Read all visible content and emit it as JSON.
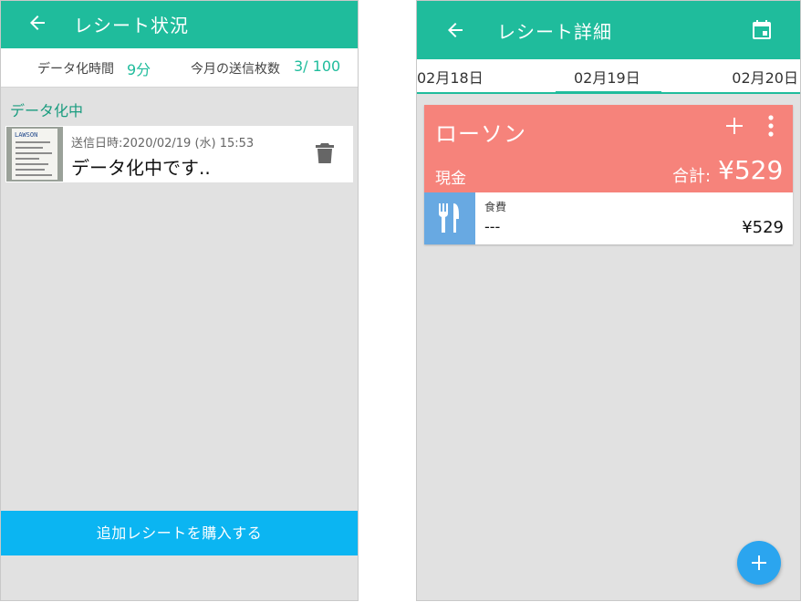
{
  "status_screen": {
    "title": "レシート状況",
    "data_time_label": "データ化時間",
    "data_time_value": "9分",
    "monthly_label": "今月の送信枚数",
    "monthly_value": "3/ 100",
    "section_title": "データ化中",
    "receipt": {
      "thumbnail_logo": "LAWSON",
      "sent": "送信日時:2020/02/19 (水) 15:53",
      "status": "データ化中です.."
    },
    "buy_button": "追加レシートを購入する"
  },
  "detail_screen": {
    "title": "レシート詳細",
    "dates": [
      "02月18日",
      "02月19日",
      "02月20日"
    ],
    "selected_date_index": 1,
    "card": {
      "store": "ローソン",
      "payment": "現金",
      "total_label": "合計:",
      "total_value": "¥529",
      "header_color": "#f6837b",
      "item": {
        "icon": "fork-knife-icon",
        "icon_color": "#68a9e2",
        "category": "食費",
        "memo": "---",
        "price": "¥529"
      }
    }
  },
  "colors": {
    "appbar": "#1fbc9c",
    "accent_text": "#1a9c7f",
    "buy_button": "#0bb5f2",
    "fab": "#2ba5ef",
    "background": "#e1e1e1"
  },
  "icons": {
    "back": "arrow-left-icon",
    "calendar": "calendar-icon",
    "delete": "trash-icon",
    "add": "plus-icon",
    "more": "more-vertical-icon"
  }
}
